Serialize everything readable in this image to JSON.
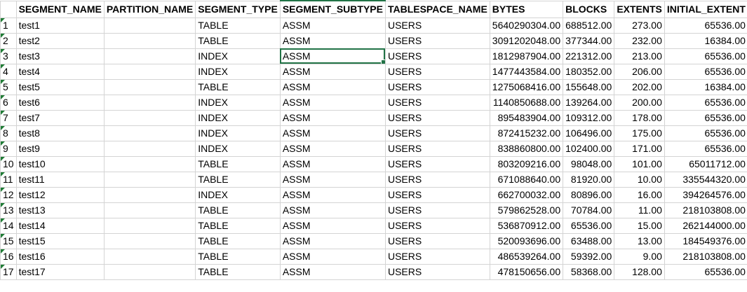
{
  "columns": [
    "",
    "SEGMENT_NAME",
    "PARTITION_NAME",
    "SEGMENT_TYPE",
    "SEGMENT_SUBTYPE",
    "TABLESPACE_NAME",
    "BYTES",
    "BLOCKS",
    "EXTENTS",
    "INITIAL_EXTENT"
  ],
  "selected_cell": {
    "row": 3,
    "col": 4
  },
  "rows": [
    [
      "1",
      "test1",
      "",
      "TABLE",
      "ASSM",
      "USERS",
      "5640290304.00",
      "688512.00",
      "273.00",
      "65536.00"
    ],
    [
      "2",
      "test2",
      "",
      "TABLE",
      "ASSM",
      "USERS",
      "3091202048.00",
      "377344.00",
      "232.00",
      "16384.00"
    ],
    [
      "3",
      "test3",
      "",
      "INDEX",
      "ASSM",
      "USERS",
      "1812987904.00",
      "221312.00",
      "213.00",
      "65536.00"
    ],
    [
      "4",
      "test4",
      "",
      "INDEX",
      "ASSM",
      "USERS",
      "1477443584.00",
      "180352.00",
      "206.00",
      "65536.00"
    ],
    [
      "5",
      "test5",
      "",
      "TABLE",
      "ASSM",
      "USERS",
      "1275068416.00",
      "155648.00",
      "202.00",
      "16384.00"
    ],
    [
      "6",
      "test6",
      "",
      "INDEX",
      "ASSM",
      "USERS",
      "1140850688.00",
      "139264.00",
      "200.00",
      "65536.00"
    ],
    [
      "7",
      "test7",
      "",
      "INDEX",
      "ASSM",
      "USERS",
      "895483904.00",
      "109312.00",
      "178.00",
      "65536.00"
    ],
    [
      "8",
      "test8",
      "",
      "INDEX",
      "ASSM",
      "USERS",
      "872415232.00",
      "106496.00",
      "175.00",
      "65536.00"
    ],
    [
      "9",
      "test9",
      "",
      "INDEX",
      "ASSM",
      "USERS",
      "838860800.00",
      "102400.00",
      "171.00",
      "65536.00"
    ],
    [
      "10",
      "test10",
      "",
      "TABLE",
      "ASSM",
      "USERS",
      "803209216.00",
      "98048.00",
      "101.00",
      "65011712.00"
    ],
    [
      "11",
      "test11",
      "",
      "TABLE",
      "ASSM",
      "USERS",
      "671088640.00",
      "81920.00",
      "10.00",
      "335544320.00"
    ],
    [
      "12",
      "test12",
      "",
      "INDEX",
      "ASSM",
      "USERS",
      "662700032.00",
      "80896.00",
      "16.00",
      "394264576.00"
    ],
    [
      "13",
      "test13",
      "",
      "TABLE",
      "ASSM",
      "USERS",
      "579862528.00",
      "70784.00",
      "11.00",
      "218103808.00"
    ],
    [
      "14",
      "test14",
      "",
      "TABLE",
      "ASSM",
      "USERS",
      "536870912.00",
      "65536.00",
      "15.00",
      "262144000.00"
    ],
    [
      "15",
      "test15",
      "",
      "TABLE",
      "ASSM",
      "USERS",
      "520093696.00",
      "63488.00",
      "13.00",
      "184549376.00"
    ],
    [
      "16",
      "test16",
      "",
      "TABLE",
      "ASSM",
      "USERS",
      "486539264.00",
      "59392.00",
      "9.00",
      "218103808.00"
    ],
    [
      "17",
      "test17",
      "",
      "TABLE",
      "ASSM",
      "USERS",
      "478150656.00",
      "58368.00",
      "128.00",
      "65536.00"
    ]
  ]
}
